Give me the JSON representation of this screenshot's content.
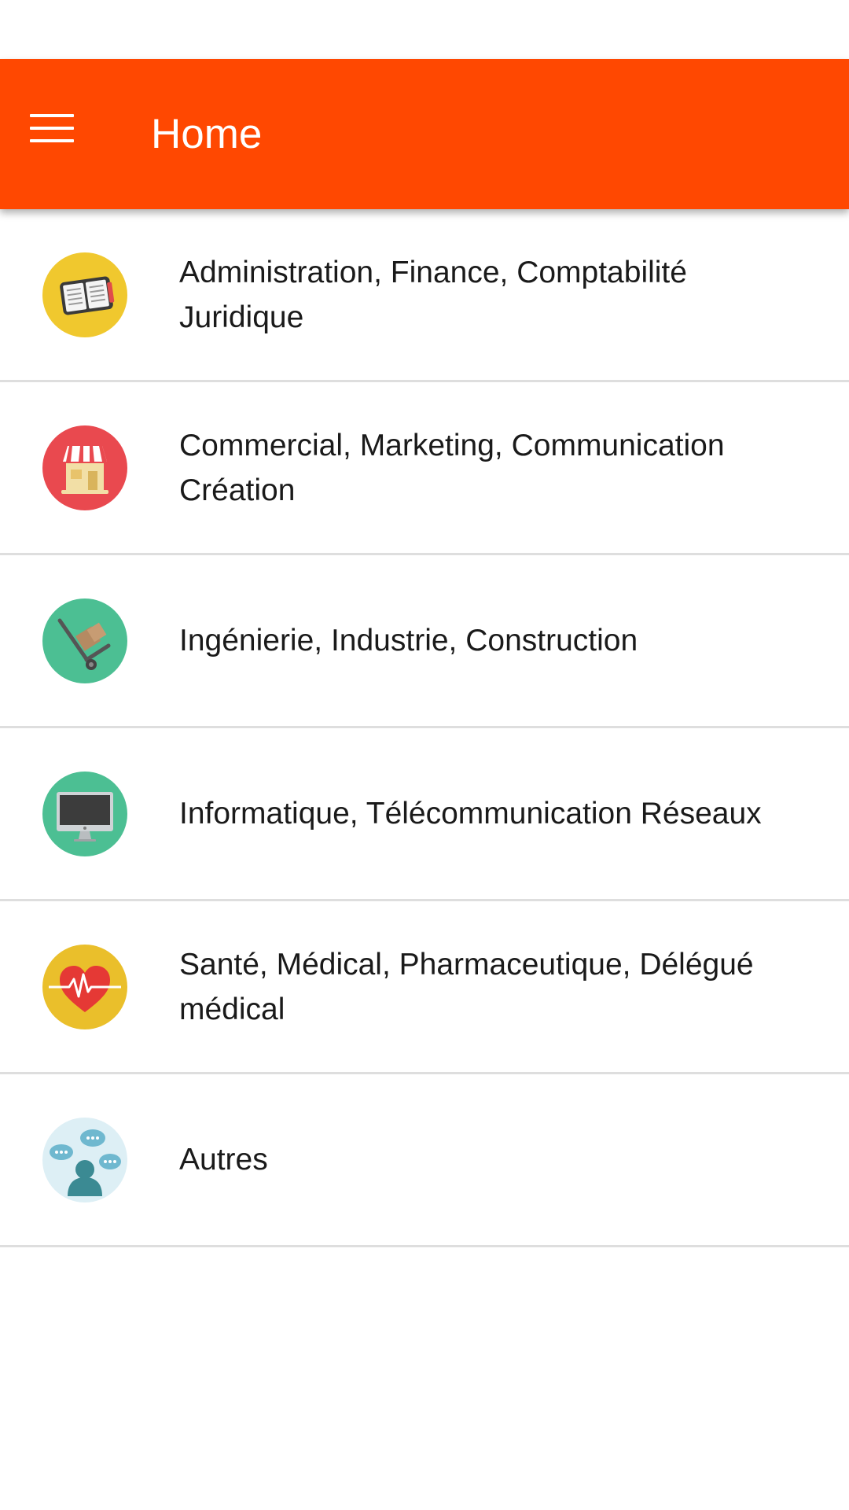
{
  "app_bar": {
    "title": "Home",
    "menu_icon": "hamburger-menu-icon",
    "background": "#FF4801"
  },
  "categories": [
    {
      "label": "Administration, Finance, Comptabilité\nJuridique",
      "icon": "notebook-icon",
      "icon_color": "#F0C82E"
    },
    {
      "label": "Commercial, Marketing, Communication\nCréation",
      "icon": "storefront-icon",
      "icon_color": "#E9494F"
    },
    {
      "label": "Ingénierie, Industrie, Construction",
      "icon": "hand-truck-icon",
      "icon_color": "#4CBF93"
    },
    {
      "label": "Informatique, Télécommunication  Réseaux",
      "icon": "computer-monitor-icon",
      "icon_color": "#4CBF93"
    },
    {
      "label": "Santé, Médical, Pharmaceutique, Délégué\nmédical",
      "icon": "heart-pulse-icon",
      "icon_color": "#EABF2B"
    },
    {
      "label": "Autres",
      "icon": "person-chat-icon",
      "icon_color": "#DDEFF5"
    }
  ]
}
